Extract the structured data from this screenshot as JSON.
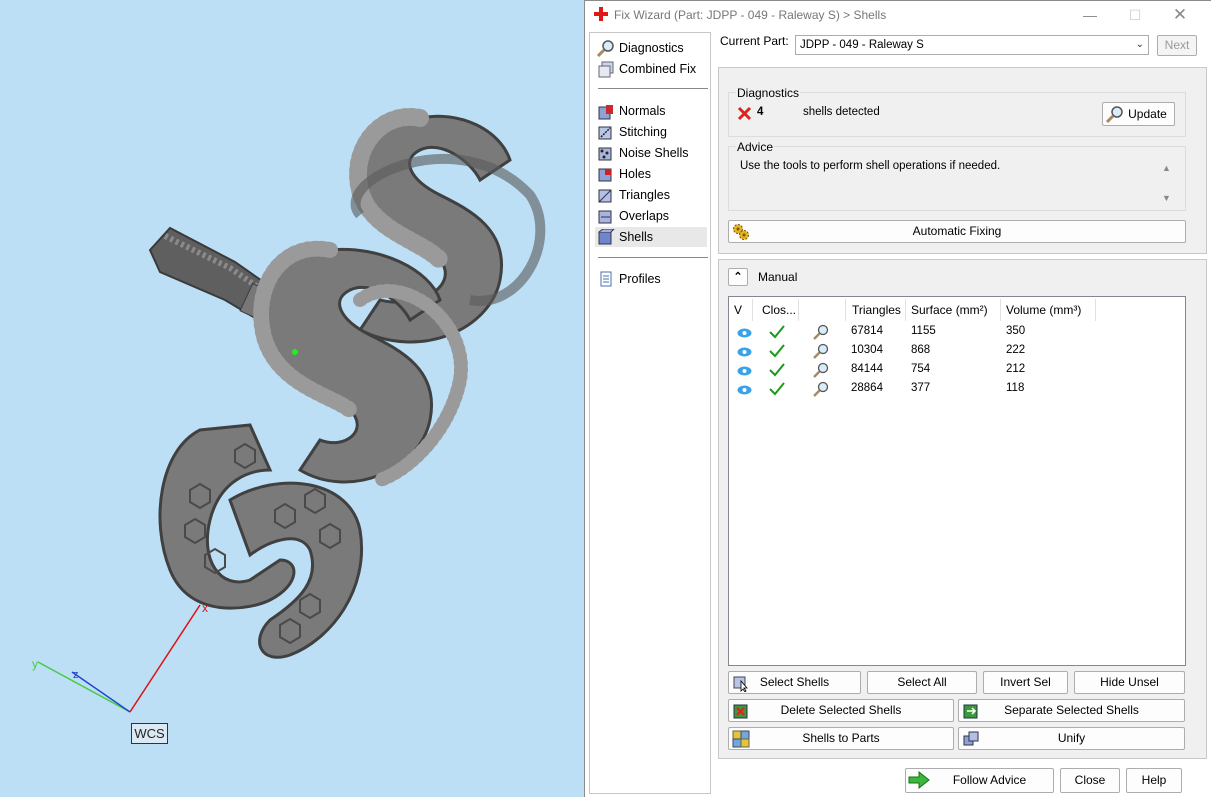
{
  "viewport": {
    "axis_x": "x",
    "axis_y": "y",
    "axis_z": "z",
    "wcs_label": "WCS"
  },
  "title": "Fix Wizard (Part: JDPP - 049 - Raleway S) > Shells",
  "nav": {
    "items": [
      {
        "label": "Diagnostics",
        "icon": "magnifier-icon"
      },
      {
        "label": "Combined Fix",
        "icon": "stacked-cubes-icon"
      },
      {
        "label": "Normals",
        "icon": "normals-cube-icon"
      },
      {
        "label": "Stitching",
        "icon": "stitching-icon"
      },
      {
        "label": "Noise Shells",
        "icon": "noise-shells-icon"
      },
      {
        "label": "Holes",
        "icon": "holes-cube-icon"
      },
      {
        "label": "Triangles",
        "icon": "triangles-cube-icon"
      },
      {
        "label": "Overlaps",
        "icon": "overlaps-cube-icon"
      },
      {
        "label": "Shells",
        "icon": "shells-cube-icon"
      },
      {
        "label": "Profiles",
        "icon": "document-icon"
      }
    ],
    "selected": "Shells"
  },
  "part": {
    "label": "Current Part:",
    "value": "JDPP - 049 - Raleway S",
    "next": "Next"
  },
  "diagnostics": {
    "title": "Diagnostics",
    "count": "4",
    "text": "shells detected",
    "update": "Update"
  },
  "advice": {
    "title": "Advice",
    "text": "Use the tools to perform shell operations if needed."
  },
  "auto_fix": "Automatic Fixing",
  "manual": {
    "title": "Manual",
    "columns": [
      "V",
      "Clos...",
      "",
      "Triangles",
      "Surface (mm²)",
      "Volume (mm³)"
    ],
    "rows": [
      {
        "triangles": "67814",
        "surface": "1155",
        "volume": "350"
      },
      {
        "triangles": "10304",
        "surface": "868",
        "volume": "222"
      },
      {
        "triangles": "84144",
        "surface": "754",
        "volume": "212"
      },
      {
        "triangles": "28864",
        "surface": "377",
        "volume": "118"
      }
    ],
    "buttons": {
      "select_shells": "Select Shells",
      "select_all": "Select All",
      "invert_sel": "Invert Sel",
      "hide_unsel": "Hide Unsel",
      "delete_selected": "Delete Selected Shells",
      "separate_selected": "Separate Selected Shells",
      "shells_to_parts": "Shells to Parts",
      "unify": "Unify"
    }
  },
  "footer": {
    "follow_advice": "Follow Advice",
    "close": "Close",
    "help": "Help"
  },
  "colors": {
    "viewport_bg": "#bcdff6",
    "model": "#6e6e6e",
    "x_axis": "#d11",
    "y_axis": "#4c4",
    "z_axis": "#24c",
    "check": "#1a9a1a",
    "error": "#d22"
  }
}
